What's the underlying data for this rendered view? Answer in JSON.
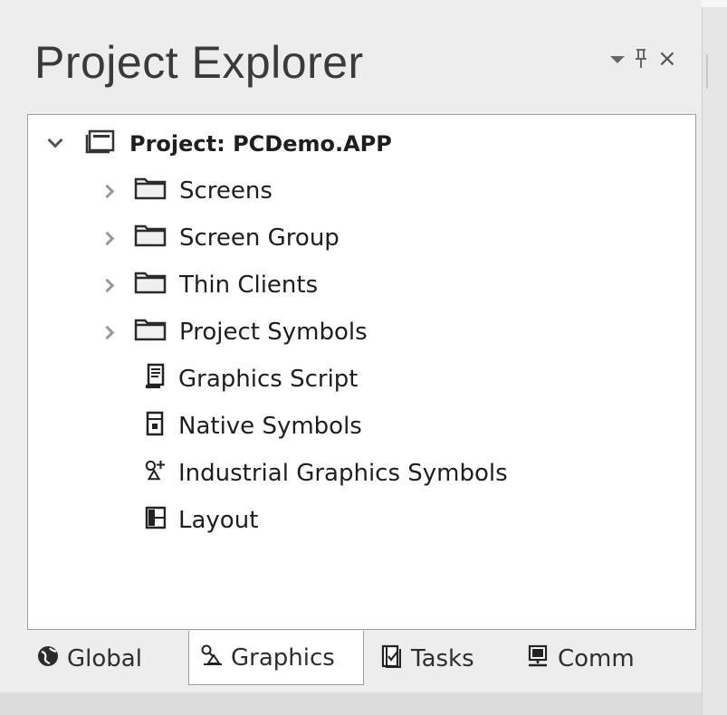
{
  "panel": {
    "title": "Project Explorer",
    "controls": [
      "dropdown-icon",
      "pin-icon",
      "close-icon"
    ],
    "close_glyph": "×",
    "pin_glyph": "ᵽ"
  },
  "tree": {
    "root": {
      "label": "Project: PCDemo.APP",
      "icon": "project-icon",
      "expanded": true
    },
    "items": [
      {
        "label": "Screens",
        "icon": "folder-icon",
        "expandable": true
      },
      {
        "label": "Screen Group",
        "icon": "folder-icon",
        "expandable": true
      },
      {
        "label": "Thin Clients",
        "icon": "folder-icon",
        "expandable": true
      },
      {
        "label": "Project Symbols",
        "icon": "folder-icon",
        "expandable": true
      },
      {
        "label": "Graphics Script",
        "icon": "script-icon",
        "expandable": false
      },
      {
        "label": "Native Symbols",
        "icon": "native-symbol-icon",
        "expandable": false
      },
      {
        "label": "Industrial Graphics Symbols",
        "icon": "industrial-symbol-icon",
        "expandable": false
      },
      {
        "label": "Layout",
        "icon": "layout-icon",
        "expandable": false
      }
    ]
  },
  "tabs": [
    {
      "label": "Global",
      "icon": "globe-icon",
      "active": false
    },
    {
      "label": "Graphics",
      "icon": "graphics-icon",
      "active": true
    },
    {
      "label": "Tasks",
      "icon": "tasks-icon",
      "active": false
    },
    {
      "label": "Comm",
      "icon": "computer-icon",
      "active": false
    }
  ]
}
